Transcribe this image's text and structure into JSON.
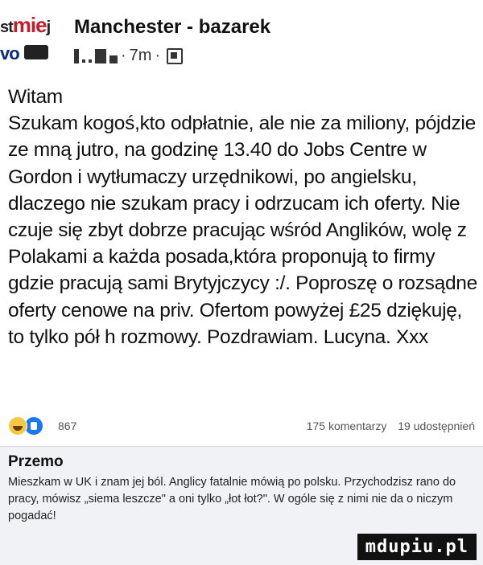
{
  "header": {
    "avatar_line1_prefix": "st",
    "avatar_line1_red": "mie",
    "avatar_line1_suffix": "j",
    "avatar_line2": "vo",
    "group_name": "Manchester - bazarek",
    "time_ago": "7m",
    "privacy_icon": "globe-icon"
  },
  "post": {
    "text": "Witam\nSzukam kogoś,kto odpłatnie, ale nie za miliony, pójdzie ze mną jutro, na godzinę 13.40 do Jobs Centre w Gordon i wytłumaczy urzędnikowi, po angielsku, dlaczego nie szukam pracy i odrzucam ich oferty. Nie czuje się zbyt dobrze pracując wśród Anglików, wolę z Polakami a każda posada,która proponują to firmy gdzie pracują sami Brytyjczycy :/. Poproszę o rozsądne oferty cenowe na priv. Ofertom powyżej £25 dziękuję, to tylko pół h rozmowy. Pozdrawiam. Lucyna. Xxx"
  },
  "stats": {
    "reaction_icons": [
      "haha-emoji-icon",
      "like-icon"
    ],
    "reactions_count": "867",
    "comments": "175 komentarzy",
    "shares": "19 udostępnień"
  },
  "comment": {
    "author": "Przemo",
    "text": "Mieszkam w UK i znam jej ból. Anglicy fatalnie mówią po polsku. Przychodzisz rano do pracy, mówisz „siema leszcze\" a oni tylko „łot łot?\". W ogóle się z nimi nie da o niczym pogadać!"
  },
  "watermark": "mdupiu.pl",
  "colors": {
    "like_blue": "#1877f2",
    "haha_yellow": "#f7c744",
    "comment_bg": "#f0f2f5"
  }
}
